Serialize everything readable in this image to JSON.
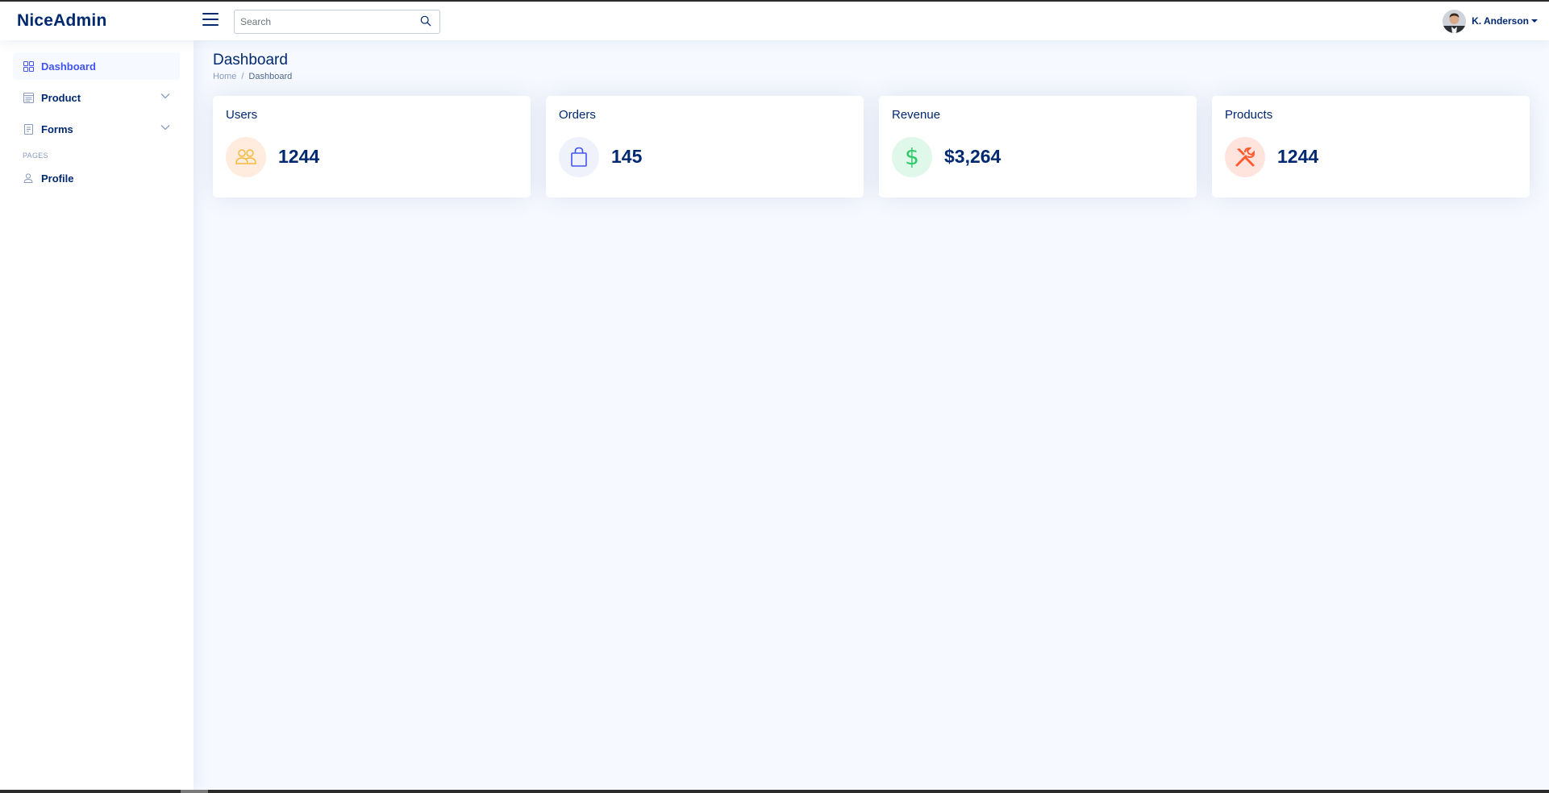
{
  "app": {
    "logo": "NiceAdmin"
  },
  "header": {
    "search": {
      "placeholder": "Search",
      "value": ""
    },
    "profile": {
      "name": "K. Anderson"
    }
  },
  "sidebar": {
    "items": [
      {
        "label": "Dashboard",
        "icon": "grid-icon",
        "active": true
      },
      {
        "label": "Product",
        "icon": "layout-text-window-icon",
        "expandable": true
      },
      {
        "label": "Forms",
        "icon": "journal-text-icon",
        "expandable": true
      }
    ],
    "heading": "PAGES",
    "pages": [
      {
        "label": "Profile",
        "icon": "person-icon"
      }
    ]
  },
  "main": {
    "title": "Dashboard",
    "breadcrumb": [
      "Home",
      "/",
      "Dashboard"
    ],
    "cards": [
      {
        "title": "Users",
        "value": "1244",
        "icon": "people-icon",
        "icon_bg": "#ffecdf",
        "icon_color": "#f6b93b"
      },
      {
        "title": "Orders",
        "value": "145",
        "icon": "shopping-bag-icon",
        "icon_bg": "#f6f6fe",
        "icon_color": "#4154f1"
      },
      {
        "title": "Revenue",
        "value": "$3,264",
        "icon": "dollar-icon",
        "icon_bg": "#e0f8e9",
        "icon_color": "#2eca6a"
      },
      {
        "title": "Products",
        "value": "1244",
        "icon": "tools-icon",
        "icon_bg": "#ffe4de",
        "icon_color": "#ff771d"
      }
    ]
  },
  "colors": {
    "primary": "#4154f1",
    "text": "#012970",
    "muted": "#899bbd",
    "background": "#f6f9ff"
  }
}
